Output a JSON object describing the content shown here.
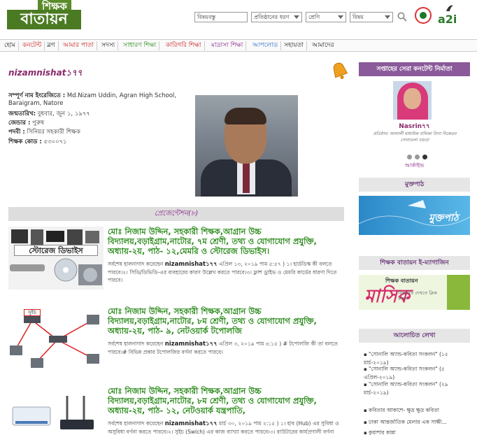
{
  "header": {
    "logo_top": "শিক্ষক",
    "logo_bottom": "বাতায়ন",
    "search_placeholder": "বিষয়বস্তু",
    "filters": [
      {
        "label": "প্রতিষ্ঠানের ধরণ"
      },
      {
        "label": "শ্রেণি"
      },
      {
        "label": "বিষয়"
      }
    ],
    "a2i_text": "a2i"
  },
  "nav": {
    "items": [
      "হোম",
      "কনটেন্ট",
      "ব্লগ",
      "আমার পাতা",
      "সদস্য",
      "সাধারণ শিক্ষা",
      "কারিগরি শিক্ষা",
      "মাদ্রাসা শিক্ষা",
      "আপলোড",
      "সহায়তা",
      "আমাদের"
    ],
    "colors": [
      "#222",
      "#c22",
      "#222",
      "#c22",
      "#222",
      "#2a8a1a",
      "#c22",
      "#8a2a8a",
      "#2a6ac8",
      "#222",
      "#222"
    ]
  },
  "profile": {
    "username": "nizamnishat১৭৭",
    "fullname_label": "সম্পূর্ণ নাম ইংরেজিতে :",
    "fullname": "Md.Nizam Uddin, Agran High School, Baraigram, Natore",
    "dob_label": "জন্মতারিখ:",
    "dob": "বুধবার, জুন ১, ১৯৭৭",
    "gender_label": "জেন্ডার :",
    "gender": "পুরুষ",
    "post_label": "পদবী :",
    "post": "সিনিয়র সহকারী শিক্ষক",
    "code_label": "শিক্ষক কোড :",
    "code": "৫৩০০৭১"
  },
  "presentations": {
    "header": "প্রেজেন্টেশন(৮)",
    "items": [
      {
        "title": "মোঃ নিজাম উদ্দিন, সহকারী শিক্ষক,আগ্রান উচ্চ বিদ্যালয়,বড়াইগ্রাম,নাটোর, ৭ম শ্রেণী, তথ্য ও যোগাযোগ প্রযুক্তি, অধ্যায়-২য়, পাঠ- ১২,মেমরি ও স্টোরেজ ডিভাইস।",
        "desc_prefix": "সর্বশেষ হালনাগাদ করেছেন",
        "author": "nizamnishat১৭৭",
        "desc_suffix": "এপ্রিল ১৩, ২০১৯ পাম ৫:৫৭ ) ১। হার্ডডিস্ক কী বলতে পারবে।২। সিডি/ডিভিডি-এর ব্যবহারের কারণ উল্লেখ করতে পারবে।৩। ফ্লাশ ড্রাইভ ও মেমরি কার্ডের ধারণা দিতে পারবে।",
        "thumb_label": "স্টোরেজ ডিভাইস"
      },
      {
        "title": "মোঃ নিজাম উদ্দিন, সহকারী শিক্ষক,আগ্রান উচ্চ বিদ্যালয়,বড়াইগ্রাম,নাটোর, ৮ম শ্রেণী, তথ্য ও যোগাযোগ প্রযুক্তি, অধ্যায়-২য়, পাঠ- ৯, নেটওয়ার্ক টপোলজি",
        "desc_prefix": "সর্বশেষ হালনাগাদ করেছেন",
        "author": "nizamnishat১৭৭",
        "desc_suffix": "এপ্রিল ৩, ২০১৯ পাম ৪:১৫ ) # টপোলজি কী তা বলতে পারবে।# বিভিন্ন প্রকার টপোলজির বর্ণনা করতে পারবে।",
        "thumb_label": "সুইচ"
      },
      {
        "title": "মোঃ নিজাম উদ্দিন, সহকারী শিক্ষক,আগ্রান উচ্চ বিদ্যালয়,বড়াইগ্রাম,নাটোর, ৮ম শ্রেণী, তথ্য ও যোগাযোগ প্রযুক্তি, অধ্যায়-২য়, পাঠ- ১২, নেটওয়ার্ক যন্ত্রপাতি,",
        "desc_prefix": "সর্বশেষ হালনাগাদ করেছেন",
        "author": "nizamnishat১৭৭",
        "desc_suffix": "মার্চ ৩০, ২০১৯ পাম ২:১৫ ) ১। হাব (Hub) এর সুবিধা ও অসুবিধা বর্ণনা করতে পারবে।২। সুইচ (Swich) এর কাজ ব্যাখ্যা করতে পারবে।৩। রাউটারের কার্যপ্রণালী বর্ণনা",
        "thumb_label": ""
      }
    ]
  },
  "sidebar": {
    "best_content_title": "সপ্তাহের সেরা কনটেন্ট নির্মাতা",
    "winner_name": "Nasrin৭৭",
    "winner_school_line1": "প্রতিষ্ঠান: জালালী মাধ্যমিক বালিকা বিদ্যা নিকেতন",
    "winner_school_line2": "সোনাতলা বগুড়া",
    "archive": "আর্কাইভ",
    "muktopath_title": "মুক্তপাঠ",
    "muktopath_banner": "মুক্তপাঠ",
    "enews_title": "শিক্ষক বাতায়ন ই-ম্যাগাজিন",
    "enews_banner_top": "শিক্ষক বাতায়ন",
    "enews_banner_big": "মাসিক",
    "enews_banner_sub": "বিস্তারিত দেখতে ক্লিক করুন",
    "recent_title": "আলোচিত লেখা",
    "recent": [
      "\"সোনালি অ্যান্ড-কবিতা সংকলন\" (১৫ মার্চ-২০১৯)",
      "\"সোনালি অ্যান্ড-কবিতা সংকলন\" (৫ এপ্রিল-২০১৯)",
      "\"সোনালি অ্যান্ড-কবিতা সংকলন\" (২৯ মার্চ-২০১৯)",
      "কবিতার আকাশে- ক্ষুদ্র ক্ষুদ্র কবিতা",
      "ঢাকা আন্তর্জাতিক মেলার এক সাক্ষী...",
      "কুয়াশার কান্না"
    ]
  }
}
